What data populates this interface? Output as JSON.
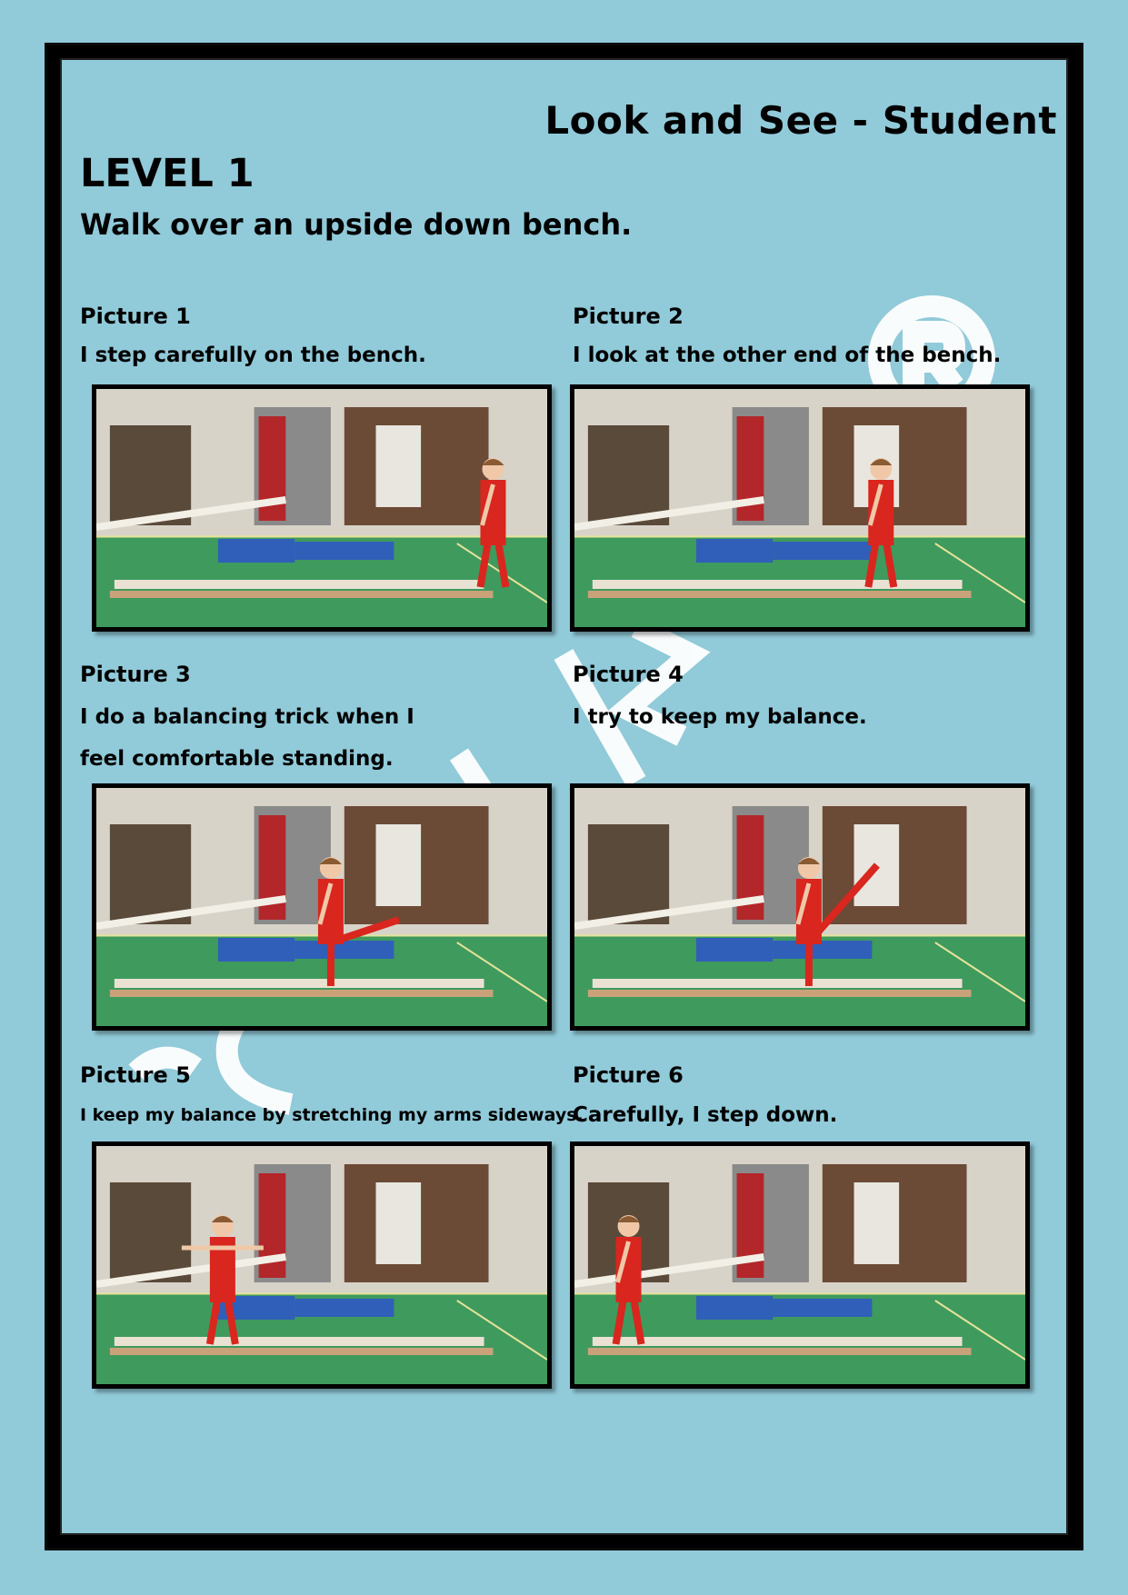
{
  "header": {
    "title": "Look and See - Student",
    "level": "LEVEL 1",
    "task": "Walk over an upside down bench."
  },
  "pictures": [
    {
      "label": "Picture 1",
      "lines": [
        "I step carefully on the bench."
      ]
    },
    {
      "label": "Picture 2",
      "lines": [
        "I look at the other end of the bench."
      ]
    },
    {
      "label": "Picture 3",
      "lines": [
        "I do a balancing trick when I",
        "feel comfortable standing."
      ]
    },
    {
      "label": "Picture 4",
      "lines": [
        "I try to keep my balance."
      ]
    },
    {
      "label": "Picture 5",
      "lines": [
        "I keep my balance by stretching my arms sideways."
      ]
    },
    {
      "label": "Picture 6",
      "lines": [
        "Carefully, I step down."
      ]
    }
  ],
  "watermark": {
    "text": "GymWijzer"
  },
  "colors": {
    "page_background": "#91cad9",
    "frame": "#000000",
    "gym_floor": "#3f9a5e",
    "mat": "#2f5fb8",
    "shirt": "#d9261e"
  }
}
